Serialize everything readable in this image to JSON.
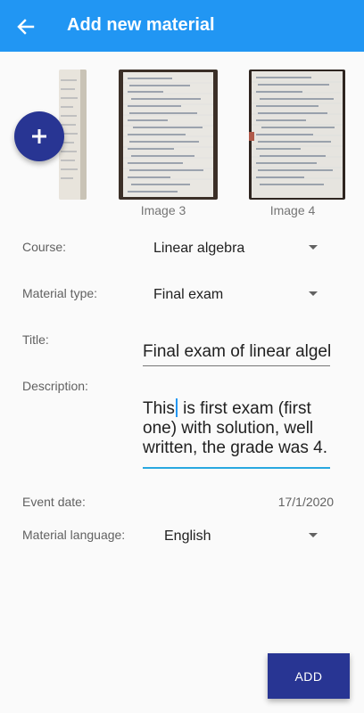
{
  "appbar": {
    "title": "Add new material",
    "back_icon": "arrow-left-icon"
  },
  "gallery": {
    "images": [
      {
        "label": ""
      },
      {
        "label": "Image 3"
      },
      {
        "label": "Image 4"
      }
    ],
    "add_icon": "plus-icon"
  },
  "form": {
    "course": {
      "label": "Course:",
      "value": "Linear algebra"
    },
    "material_type": {
      "label": "Material type:",
      "value": "Final exam"
    },
    "title": {
      "label": "Title:",
      "value": "Final exam of linear algebra"
    },
    "description": {
      "label": "Description:",
      "before_cursor": "This",
      "after_cursor": " is first exam (first one) with solution, well written, the grade was 4."
    },
    "event_date": {
      "label": "Event date:",
      "value": "17/1/2020"
    },
    "material_language": {
      "label": "Material language:",
      "value": "English"
    }
  },
  "actions": {
    "add_label": "ADD"
  },
  "colors": {
    "appbar": "#2196f3",
    "accent": "#283593",
    "focus_underline": "#29a8e0"
  }
}
